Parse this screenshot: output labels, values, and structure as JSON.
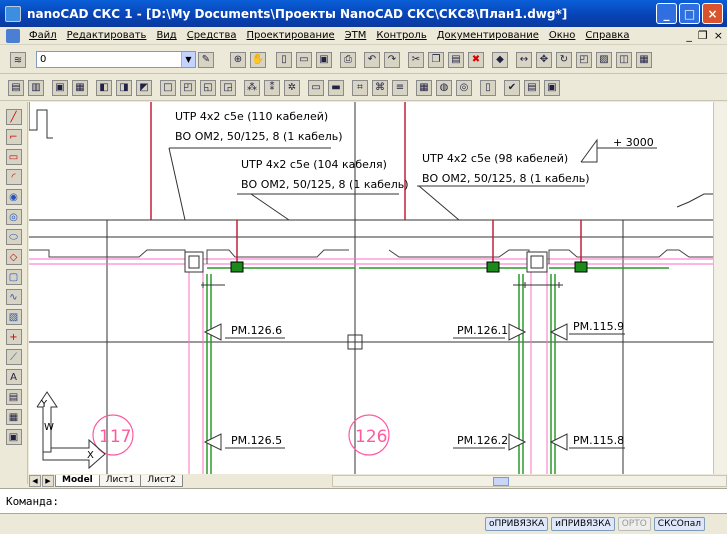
{
  "window": {
    "title": "nanoCAD СКС 1 - [D:\\My Documents\\Проекты NanoCAD СКС\\СКС8\\План1.dwg*]",
    "buttons": [
      "_",
      "□",
      "×"
    ]
  },
  "menu": {
    "items": [
      "Файл",
      "Редактировать",
      "Вид",
      "Средства",
      "Проектирование",
      "ЭТМ",
      "Контроль",
      "Документирование",
      "Окно",
      "Справка"
    ],
    "mdi_buttons": [
      "_",
      "❐",
      "×"
    ]
  },
  "toolbar": {
    "layer_value": "0"
  },
  "drawing": {
    "cable_labels": [
      {
        "line1": "UTP 4x2 c5e (110 кабелей)",
        "line2": "ВО ОМ2, 50/125, 8 (1 кабель)"
      },
      {
        "line1": "UTP 4x2 c5e (104 кабеля)",
        "line2": "ВО ОМ2, 50/125, 8 (1 кабель)"
      },
      {
        "line1": "UTP 4x2 c5e (98 кабелей)",
        "line2": "ВО ОМ2, 50/125, 8 (1 кабель)"
      }
    ],
    "elevation": "+ 3000",
    "outlets": [
      "РМ.126.6",
      "РМ.126.1",
      "РМ.115.9",
      "РМ.126.5",
      "РМ.126.2",
      "РМ.115.8"
    ],
    "rooms": [
      "117",
      "126"
    ],
    "ucs_labels": {
      "y": "Y",
      "w": "W",
      "x": "X"
    }
  },
  "tabs": {
    "items": [
      "Model",
      "Лист1",
      "Лист2"
    ],
    "active": "Model"
  },
  "command": {
    "prompt": "Команда:"
  },
  "status": {
    "buttons": [
      {
        "label": "оПРИВЯЗКА",
        "on": true
      },
      {
        "label": "иПРИВЯЗКА",
        "on": true
      },
      {
        "label": "ОРТО",
        "on": false
      },
      {
        "label": "СКСОпал",
        "on": true
      }
    ]
  },
  "colors": {
    "title_blue": "#0842b4",
    "wall_pink": "#ff6ec7",
    "cable_green": "#2a9a2a",
    "riser_red": "#c0203a",
    "room_circle": "#ff5aa0"
  }
}
